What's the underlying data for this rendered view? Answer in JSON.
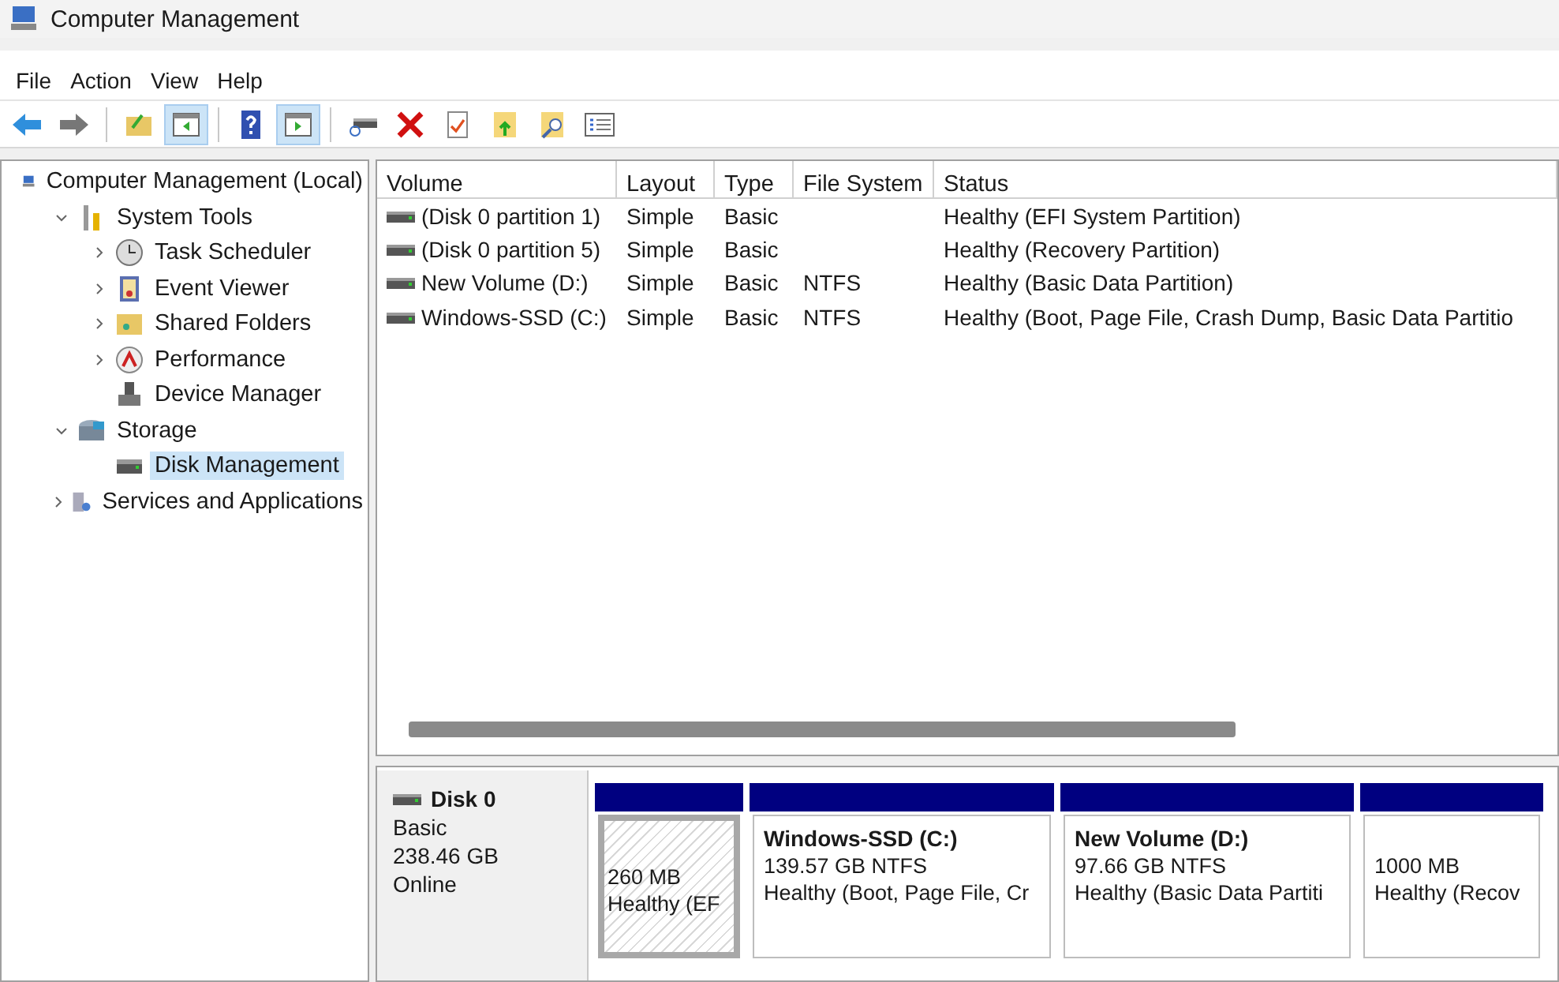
{
  "window": {
    "title": "Computer Management"
  },
  "menu": [
    "File",
    "Action",
    "View",
    "Help"
  ],
  "toolbar": [
    [
      {
        "kind": "back",
        "pressed": false
      },
      {
        "kind": "forward",
        "pressed": false
      }
    ],
    [
      {
        "kind": "up",
        "pressed": false
      },
      {
        "kind": "tree",
        "pressed": true
      }
    ],
    [
      {
        "kind": "help",
        "pressed": false
      },
      {
        "kind": "pane",
        "pressed": true
      }
    ],
    [
      {
        "kind": "drive",
        "pressed": false
      },
      {
        "kind": "delete",
        "pressed": false
      },
      {
        "kind": "check",
        "pressed": false
      },
      {
        "kind": "folderup",
        "pressed": false
      },
      {
        "kind": "search",
        "pressed": false
      },
      {
        "kind": "list",
        "pressed": false
      }
    ]
  ],
  "tree": [
    {
      "label": "Computer Management (Local)",
      "selected": false,
      "children": [
        {
          "label": "System Tools",
          "expanded": true,
          "selected": false,
          "children": [
            {
              "label": "Task Scheduler",
              "expanded": false,
              "selected": false
            },
            {
              "label": "Event Viewer",
              "expanded": false,
              "selected": false
            },
            {
              "label": "Shared Folders",
              "expanded": false,
              "selected": false
            },
            {
              "label": "Performance",
              "expanded": false,
              "selected": false
            },
            {
              "label": "Device Manager",
              "selected": false
            }
          ]
        },
        {
          "label": "Storage",
          "expanded": true,
          "selected": false,
          "children": [
            {
              "label": "Disk Management",
              "selected": true
            }
          ]
        },
        {
          "label": "Services and Applications",
          "expanded": false,
          "selected": false
        }
      ]
    }
  ],
  "table": {
    "columns": [
      "Volume",
      "Layout",
      "Type",
      "File System",
      "Status"
    ],
    "rows": [
      [
        "(Disk 0 partition 1)",
        "Simple",
        "Basic",
        "",
        "Healthy (EFI System Partition)"
      ],
      [
        "(Disk 0 partition 5)",
        "Simple",
        "Basic",
        "",
        "Healthy (Recovery Partition)"
      ],
      [
        "New Volume (D:)",
        "Simple",
        "Basic",
        "NTFS",
        "Healthy (Basic Data Partition)"
      ],
      [
        "Windows-SSD (C:)",
        "Simple",
        "Basic",
        "NTFS",
        "Healthy (Boot, Page File, Crash Dump, Basic Data Partitio"
      ]
    ]
  },
  "disk": {
    "name": "Disk 0",
    "type": "Basic",
    "size": "238.46 GB",
    "state": "Online",
    "partitions": [
      {
        "size": "260 MB",
        "status": "Healthy (EF",
        "selected": true
      },
      {
        "name": "Windows-SSD  (C:)",
        "size": "139.57 GB NTFS",
        "status": "Healthy (Boot, Page File, Cr",
        "selected": false
      },
      {
        "name": "New Volume  (D:)",
        "size": "97.66 GB NTFS",
        "status": "Healthy (Basic Data Partiti",
        "selected": false
      },
      {
        "size": "1000 MB",
        "status": "Healthy (Recov",
        "selected": false
      }
    ]
  }
}
